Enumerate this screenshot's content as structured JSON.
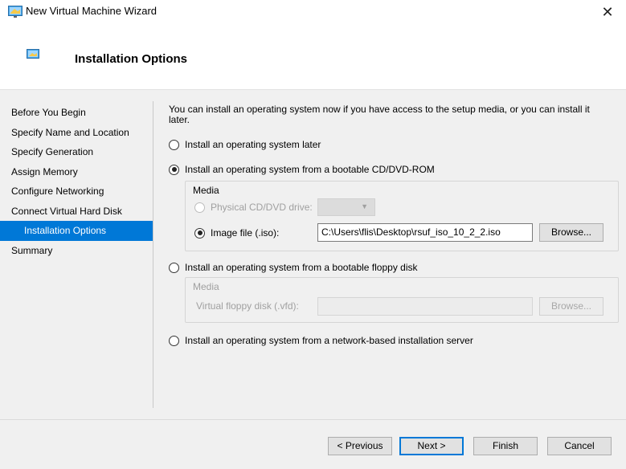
{
  "window": {
    "title": "New Virtual Machine Wizard",
    "close_glyph": "✕"
  },
  "header": {
    "heading": "Installation Options"
  },
  "nav": {
    "items": [
      {
        "label": "Before You Begin"
      },
      {
        "label": "Specify Name and Location"
      },
      {
        "label": "Specify Generation"
      },
      {
        "label": "Assign Memory"
      },
      {
        "label": "Configure Networking"
      },
      {
        "label": "Connect Virtual Hard Disk"
      },
      {
        "label": "Installation Options",
        "active": true
      },
      {
        "label": "Summary"
      }
    ]
  },
  "content": {
    "intro": "You can install an operating system now if you have access to the setup media, or you can install it later.",
    "option_later": "Install an operating system later",
    "option_cd": "Install an operating system from a bootable CD/DVD-ROM",
    "cd_media": {
      "legend": "Media",
      "physical_label": "Physical CD/DVD drive:",
      "physical_value": "",
      "image_label": "Image file (.iso):",
      "image_value": "C:\\Users\\flis\\Desktop\\rsuf_iso_10_2_2.iso",
      "browse_label": "Browse..."
    },
    "option_floppy": "Install an operating system from a bootable floppy disk",
    "floppy_media": {
      "legend": "Media",
      "vfd_label": "Virtual floppy disk (.vfd):",
      "vfd_value": "",
      "browse_label": "Browse..."
    },
    "option_network": "Install an operating system from a network-based installation server",
    "selected_option": "cd"
  },
  "footer": {
    "previous_label": "< Previous",
    "next_label": "Next >",
    "finish_label": "Finish",
    "cancel_label": "Cancel"
  },
  "colors": {
    "accent": "#0078d7",
    "panel_bg": "#f0f0f0"
  }
}
